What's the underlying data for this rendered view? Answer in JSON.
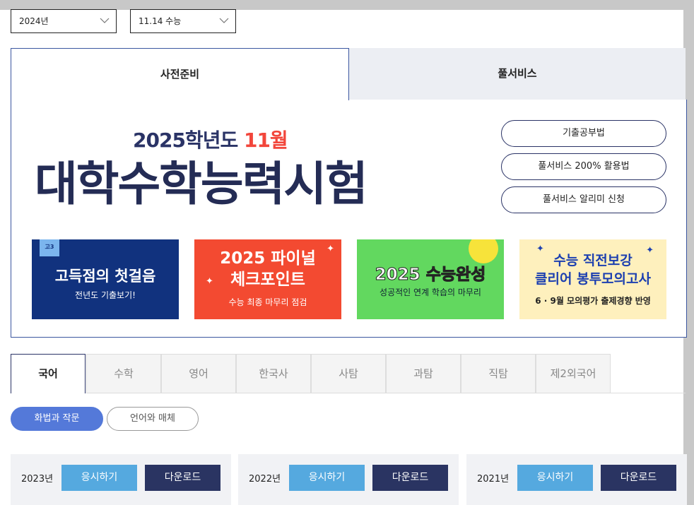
{
  "filters": {
    "year": "2024년",
    "exam": "11.14 수능"
  },
  "top_tabs": [
    {
      "label": "사전준비",
      "active": true
    },
    {
      "label": "풀서비스",
      "active": false
    }
  ],
  "hero": {
    "subtitle_prefix": "2025학년도 ",
    "subtitle_accent": "11월",
    "title": "대학수학능력시험",
    "accent_color": "#f2463b"
  },
  "links": [
    {
      "label": "기출공부법"
    },
    {
      "label": "풀서비스 200% 활용법"
    },
    {
      "label": "풀서비스 알리미 신청"
    }
  ],
  "banners": [
    {
      "tag": "고3",
      "title": "고득점의 첫걸음",
      "desc": "전년도 기출보기!"
    },
    {
      "title_line1": "2025 파이널",
      "title_line2": "체크포인트",
      "desc": "수능 최종 마무리 점검"
    },
    {
      "title_prefix": "2025 ",
      "title_accent": "수능완성",
      "desc": "성공적인 연계 학습의 마무리"
    },
    {
      "title_line1": "수능 직전보강",
      "title_line2": "클리어 봉투모의고사",
      "desc": "6 · 9월 모의평가 출제경향 반영"
    }
  ],
  "subject_tabs": [
    {
      "label": "국어",
      "active": true
    },
    {
      "label": "수학"
    },
    {
      "label": "영어"
    },
    {
      "label": "한국사"
    },
    {
      "label": "사탐"
    },
    {
      "label": "과탐"
    },
    {
      "label": "직탐"
    },
    {
      "label": "제2외국어"
    }
  ],
  "chips": [
    {
      "label": "화법과 작문",
      "active": true
    },
    {
      "label": "언어와 매체",
      "active": false
    }
  ],
  "year_cards": [
    {
      "year": "2023년",
      "take_label": "응시하기",
      "download_label": "다운로드"
    },
    {
      "year": "2022년",
      "take_label": "응시하기",
      "download_label": "다운로드"
    },
    {
      "year": "2021년",
      "take_label": "응시하기",
      "download_label": "다운로드"
    }
  ]
}
